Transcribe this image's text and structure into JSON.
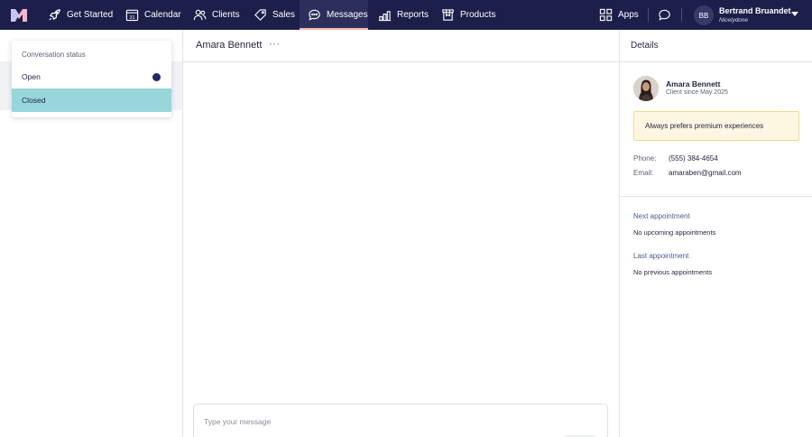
{
  "nav": {
    "items": [
      {
        "label": "Get Started",
        "icon": "rocket-icon"
      },
      {
        "label": "Calendar",
        "icon": "calendar-icon",
        "icon_text": "31"
      },
      {
        "label": "Clients",
        "icon": "users-icon"
      },
      {
        "label": "Sales",
        "icon": "tag-icon"
      },
      {
        "label": "Messages",
        "icon": "chat-icon",
        "active": true
      },
      {
        "label": "Reports",
        "icon": "bar-chart-icon"
      },
      {
        "label": "Products",
        "icon": "box-icon"
      }
    ],
    "apps_label": "Apps",
    "user": {
      "initials": "BB",
      "name": "Bertrand Bruandet",
      "org": "Nicelydone"
    }
  },
  "status_menu": {
    "header": "Conversation status",
    "options": [
      {
        "label": "Open",
        "selected": true
      },
      {
        "label": "Closed",
        "highlighted": true
      }
    ]
  },
  "conversation": {
    "title": "Amara Bennett",
    "more": "···",
    "input_placeholder": "Type your message"
  },
  "details": {
    "title": "Details",
    "client_name": "Amara Bennett",
    "client_since": "Client since May 2025",
    "note": "Always prefers premium experiences",
    "phone_label": "Phone:",
    "phone": "(555) 384-4654",
    "email_label": "Email:",
    "email": "amaraben@gmail.com",
    "next_label": "Next appointment",
    "next_value": "No upcoming appointments",
    "last_label": "Last appointment",
    "last_value": "No previous appointments"
  },
  "colors": {
    "nav_bg": "#1c1f4a",
    "active_underline": "#f2b8a7",
    "closed_highlight": "#97d7da",
    "radio": "#23286a",
    "note_bg": "#fdf7e1"
  }
}
